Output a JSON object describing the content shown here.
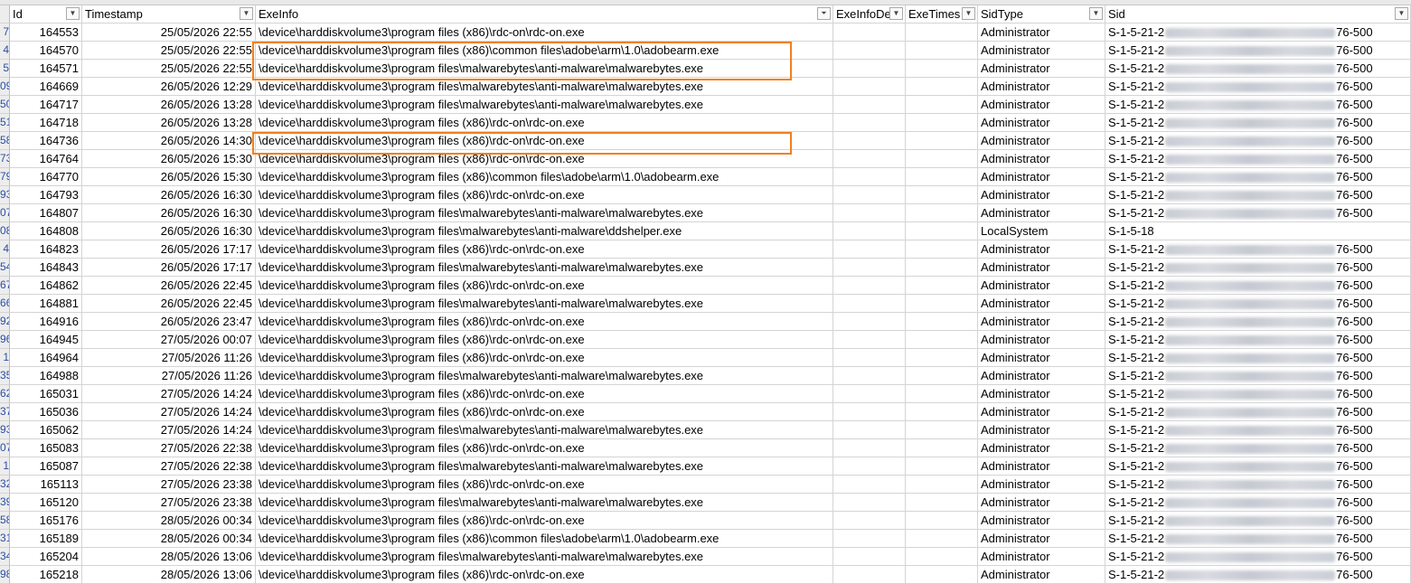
{
  "headers": {
    "id": "Id",
    "timestamp": "Timestamp",
    "exeinfo": "ExeInfo",
    "exeinfode": "ExeInfoDe",
    "exetimes": "ExeTimes",
    "sidtype": "SidType",
    "sid": "Sid"
  },
  "rows": [
    {
      "rn": "7",
      "id": "164553",
      "ts": "25/05/2026 22:55",
      "exe": "\\device\\harddiskvolume3\\program files (x86)\\rdc-on\\rdc-on.exe",
      "st": "Administrator",
      "sidp": "S-1-5-21-2",
      "sids": "76-500"
    },
    {
      "rn": "4",
      "id": "164570",
      "ts": "25/05/2026 22:55",
      "exe": "\\device\\harddiskvolume3\\program files (x86)\\common files\\adobe\\arm\\1.0\\adobearm.exe",
      "st": "Administrator",
      "sidp": "S-1-5-21-2",
      "sids": "76-500"
    },
    {
      "rn": "5",
      "id": "164571",
      "ts": "25/05/2026 22:55",
      "exe": "\\device\\harddiskvolume3\\program files\\malwarebytes\\anti-malware\\malwarebytes.exe",
      "st": "Administrator",
      "sidp": "S-1-5-21-2",
      "sids": "76-500"
    },
    {
      "rn": "09",
      "id": "164669",
      "ts": "26/05/2026 12:29",
      "exe": "\\device\\harddiskvolume3\\program files\\malwarebytes\\anti-malware\\malwarebytes.exe",
      "st": "Administrator",
      "sidp": "S-1-5-21-2",
      "sids": "76-500"
    },
    {
      "rn": "50",
      "id": "164717",
      "ts": "26/05/2026 13:28",
      "exe": "\\device\\harddiskvolume3\\program files\\malwarebytes\\anti-malware\\malwarebytes.exe",
      "st": "Administrator",
      "sidp": "S-1-5-21-2",
      "sids": "76-500"
    },
    {
      "rn": "51",
      "id": "164718",
      "ts": "26/05/2026 13:28",
      "exe": "\\device\\harddiskvolume3\\program files (x86)\\rdc-on\\rdc-on.exe",
      "st": "Administrator",
      "sidp": "S-1-5-21-2",
      "sids": "76-500"
    },
    {
      "rn": "58",
      "id": "164736",
      "ts": "26/05/2026 14:30",
      "exe": "\\device\\harddiskvolume3\\program files (x86)\\rdc-on\\rdc-on.exe",
      "st": "Administrator",
      "sidp": "S-1-5-21-2",
      "sids": "76-500"
    },
    {
      "rn": "73",
      "id": "164764",
      "ts": "26/05/2026 15:30",
      "exe": "\\device\\harddiskvolume3\\program files (x86)\\rdc-on\\rdc-on.exe",
      "st": "Administrator",
      "sidp": "S-1-5-21-2",
      "sids": "76-500"
    },
    {
      "rn": "79",
      "id": "164770",
      "ts": "26/05/2026 15:30",
      "exe": "\\device\\harddiskvolume3\\program files (x86)\\common files\\adobe\\arm\\1.0\\adobearm.exe",
      "st": "Administrator",
      "sidp": "S-1-5-21-2",
      "sids": "76-500"
    },
    {
      "rn": "93",
      "id": "164793",
      "ts": "26/05/2026 16:30",
      "exe": "\\device\\harddiskvolume3\\program files (x86)\\rdc-on\\rdc-on.exe",
      "st": "Administrator",
      "sidp": "S-1-5-21-2",
      "sids": "76-500"
    },
    {
      "rn": "07",
      "id": "164807",
      "ts": "26/05/2026 16:30",
      "exe": "\\device\\harddiskvolume3\\program files\\malwarebytes\\anti-malware\\malwarebytes.exe",
      "st": "Administrator",
      "sidp": "S-1-5-21-2",
      "sids": "76-500"
    },
    {
      "rn": "08",
      "id": "164808",
      "ts": "26/05/2026 16:30",
      "exe": "\\device\\harddiskvolume3\\program files\\malwarebytes\\anti-malware\\ddshelper.exe",
      "st": "LocalSystem",
      "sidp": "S-1-5-18",
      "sids": ""
    },
    {
      "rn": "4",
      "id": "164823",
      "ts": "26/05/2026 17:17",
      "exe": "\\device\\harddiskvolume3\\program files (x86)\\rdc-on\\rdc-on.exe",
      "st": "Administrator",
      "sidp": "S-1-5-21-2",
      "sids": "76-500"
    },
    {
      "rn": "54",
      "id": "164843",
      "ts": "26/05/2026 17:17",
      "exe": "\\device\\harddiskvolume3\\program files\\malwarebytes\\anti-malware\\malwarebytes.exe",
      "st": "Administrator",
      "sidp": "S-1-5-21-2",
      "sids": "76-500"
    },
    {
      "rn": "67",
      "id": "164862",
      "ts": "26/05/2026 22:45",
      "exe": "\\device\\harddiskvolume3\\program files (x86)\\rdc-on\\rdc-on.exe",
      "st": "Administrator",
      "sidp": "S-1-5-21-2",
      "sids": "76-500"
    },
    {
      "rn": "66",
      "id": "164881",
      "ts": "26/05/2026 22:45",
      "exe": "\\device\\harddiskvolume3\\program files\\malwarebytes\\anti-malware\\malwarebytes.exe",
      "st": "Administrator",
      "sidp": "S-1-5-21-2",
      "sids": "76-500"
    },
    {
      "rn": "92",
      "id": "164916",
      "ts": "26/05/2026 23:47",
      "exe": "\\device\\harddiskvolume3\\program files (x86)\\rdc-on\\rdc-on.exe",
      "st": "Administrator",
      "sidp": "S-1-5-21-2",
      "sids": "76-500"
    },
    {
      "rn": "96",
      "id": "164945",
      "ts": "27/05/2026 00:07",
      "exe": "\\device\\harddiskvolume3\\program files (x86)\\rdc-on\\rdc-on.exe",
      "st": "Administrator",
      "sidp": "S-1-5-21-2",
      "sids": "76-500"
    },
    {
      "rn": "1",
      "id": "164964",
      "ts": "27/05/2026 11:26",
      "exe": "\\device\\harddiskvolume3\\program files (x86)\\rdc-on\\rdc-on.exe",
      "st": "Administrator",
      "sidp": "S-1-5-21-2",
      "sids": "76-500"
    },
    {
      "rn": "35",
      "id": "164988",
      "ts": "27/05/2026 11:26",
      "exe": "\\device\\harddiskvolume3\\program files\\malwarebytes\\anti-malware\\malwarebytes.exe",
      "st": "Administrator",
      "sidp": "S-1-5-21-2",
      "sids": "76-500"
    },
    {
      "rn": "62",
      "id": "165031",
      "ts": "27/05/2026 14:24",
      "exe": "\\device\\harddiskvolume3\\program files (x86)\\rdc-on\\rdc-on.exe",
      "st": "Administrator",
      "sidp": "S-1-5-21-2",
      "sids": "76-500"
    },
    {
      "rn": "37",
      "id": "165036",
      "ts": "27/05/2026 14:24",
      "exe": "\\device\\harddiskvolume3\\program files (x86)\\rdc-on\\rdc-on.exe",
      "st": "Administrator",
      "sidp": "S-1-5-21-2",
      "sids": "76-500"
    },
    {
      "rn": "93",
      "id": "165062",
      "ts": "27/05/2026 14:24",
      "exe": "\\device\\harddiskvolume3\\program files\\malwarebytes\\anti-malware\\malwarebytes.exe",
      "st": "Administrator",
      "sidp": "S-1-5-21-2",
      "sids": "76-500"
    },
    {
      "rn": "07",
      "id": "165083",
      "ts": "27/05/2026 22:38",
      "exe": "\\device\\harddiskvolume3\\program files (x86)\\rdc-on\\rdc-on.exe",
      "st": "Administrator",
      "sidp": "S-1-5-21-2",
      "sids": "76-500"
    },
    {
      "rn": "1",
      "id": "165087",
      "ts": "27/05/2026 22:38",
      "exe": "\\device\\harddiskvolume3\\program files\\malwarebytes\\anti-malware\\malwarebytes.exe",
      "st": "Administrator",
      "sidp": "S-1-5-21-2",
      "sids": "76-500"
    },
    {
      "rn": "32",
      "id": "165113",
      "ts": "27/05/2026 23:38",
      "exe": "\\device\\harddiskvolume3\\program files (x86)\\rdc-on\\rdc-on.exe",
      "st": "Administrator",
      "sidp": "S-1-5-21-2",
      "sids": "76-500"
    },
    {
      "rn": "39",
      "id": "165120",
      "ts": "27/05/2026 23:38",
      "exe": "\\device\\harddiskvolume3\\program files\\malwarebytes\\anti-malware\\malwarebytes.exe",
      "st": "Administrator",
      "sidp": "S-1-5-21-2",
      "sids": "76-500"
    },
    {
      "rn": "58",
      "id": "165176",
      "ts": "28/05/2026 00:34",
      "exe": "\\device\\harddiskvolume3\\program files (x86)\\rdc-on\\rdc-on.exe",
      "st": "Administrator",
      "sidp": "S-1-5-21-2",
      "sids": "76-500"
    },
    {
      "rn": "31",
      "id": "165189",
      "ts": "28/05/2026 00:34",
      "exe": "\\device\\harddiskvolume3\\program files (x86)\\common files\\adobe\\arm\\1.0\\adobearm.exe",
      "st": "Administrator",
      "sidp": "S-1-5-21-2",
      "sids": "76-500"
    },
    {
      "rn": "34",
      "id": "165204",
      "ts": "28/05/2026 13:06",
      "exe": "\\device\\harddiskvolume3\\program files\\malwarebytes\\anti-malware\\malwarebytes.exe",
      "st": "Administrator",
      "sidp": "S-1-5-21-2",
      "sids": "76-500"
    },
    {
      "rn": "98",
      "id": "165218",
      "ts": "28/05/2026 13:06",
      "exe": "\\device\\harddiskvolume3\\program files (x86)\\rdc-on\\rdc-on.exe",
      "st": "Administrator",
      "sidp": "S-1-5-21-2",
      "sids": "76-500"
    }
  ],
  "filter_icons": {
    "standard": "filter-dropdown-icon",
    "active": "filter-active-icon"
  },
  "accent_color": "#f0801e"
}
